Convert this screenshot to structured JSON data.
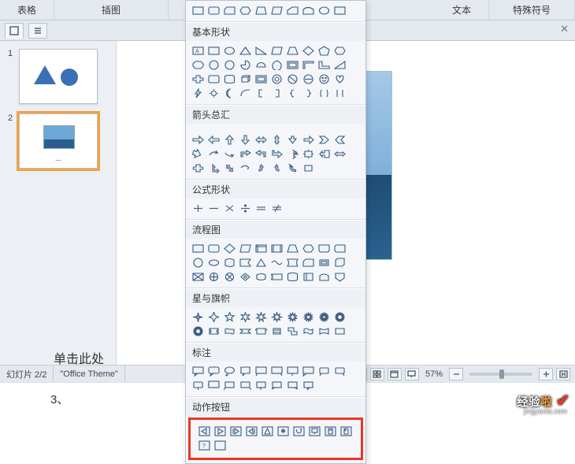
{
  "ribbon": {
    "group_table": "表格",
    "group_insert": "插图",
    "group_text": "文本",
    "group_special": "特殊符号"
  },
  "slides": {
    "items": [
      {
        "num": "1"
      },
      {
        "num": "2"
      }
    ]
  },
  "shapes_panel": {
    "sect_recent_rows": 1,
    "sect_basic": "基本形状",
    "sect_arrows": "箭头总汇",
    "sect_formula": "公式形状",
    "sect_flow": "流程图",
    "sect_stars": "星与旗帜",
    "sect_callouts": "标注",
    "sect_action": "动作按钮"
  },
  "canvas": {
    "placeholder": "单击此处"
  },
  "status": {
    "slide_of": "幻灯片 2/2",
    "theme": "\"Office Theme\"",
    "zoom_pct": "57%"
  },
  "footer": {
    "num": "3、"
  },
  "watermark": {
    "text_a": "经验",
    "text_b": "啦",
    "sub": "jingyanla.com"
  }
}
